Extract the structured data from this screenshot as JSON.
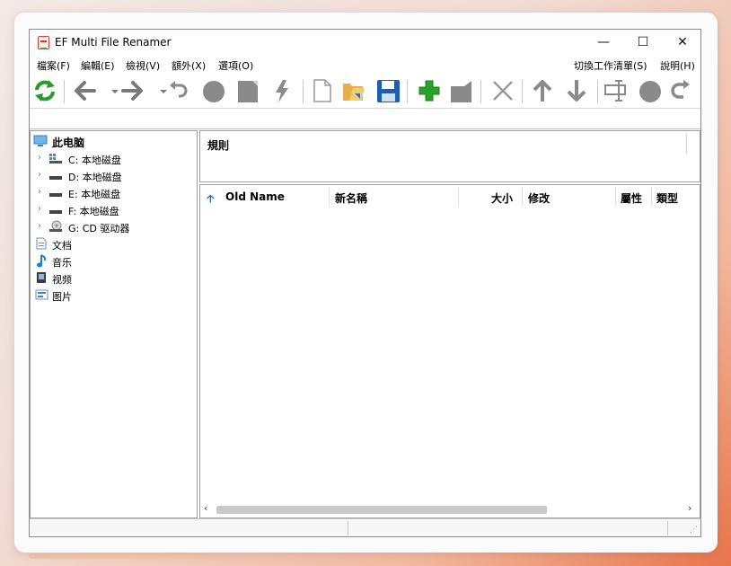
{
  "window": {
    "title": "EF Multi File Renamer"
  },
  "controls": {
    "minimize": "—",
    "maximize": "☐",
    "close": "✕"
  },
  "menu": {
    "file": "檔案(F)",
    "edit": "編輯(E)",
    "view": "檢視(V)",
    "extra": "額外(X)",
    "options": "選項(O)",
    "switch_list": "切換工作清單(S)",
    "help": "說明(H)"
  },
  "toolbar": [
    "refresh-icon",
    "back-icon",
    "back-dropdown-icon",
    "forward-icon",
    "forward-dropdown-icon",
    "undo-icon",
    "circle-icon",
    "square-icon",
    "lightning-icon",
    "new-file-icon",
    "open-folder-icon",
    "save-icon",
    "add-rule-icon",
    "tag-icon",
    "delete-icon",
    "move-up-icon",
    "move-down-icon",
    "rename-tool-icon",
    "circle-icon",
    "redo-icon"
  ],
  "tree": {
    "root": "此电脑",
    "drives": [
      {
        "label": "C: 本地磁盘",
        "icon": "windows-drive-icon"
      },
      {
        "label": "D: 本地磁盘",
        "icon": "drive-icon"
      },
      {
        "label": "E: 本地磁盘",
        "icon": "drive-icon"
      },
      {
        "label": "F: 本地磁盘",
        "icon": "drive-icon"
      },
      {
        "label": "G: CD 驱动器",
        "icon": "cd-drive-icon"
      }
    ],
    "libraries": [
      {
        "label": "文档",
        "icon": "document-icon"
      },
      {
        "label": "音乐",
        "icon": "music-icon"
      },
      {
        "label": "视频",
        "icon": "video-icon"
      },
      {
        "label": "图片",
        "icon": "picture-icon"
      }
    ]
  },
  "rules": {
    "title": "規則"
  },
  "files": {
    "sort_indicator": "🡡",
    "columns": {
      "old_name": "Old Name",
      "new_name": "新名稱",
      "size": "大小",
      "modified": "修改",
      "attributes": "屬性",
      "type": "類型"
    }
  },
  "colors": {
    "accent": "#2a8a2a",
    "arrow": "#7a7a7a",
    "save": "#1a5fb4"
  }
}
